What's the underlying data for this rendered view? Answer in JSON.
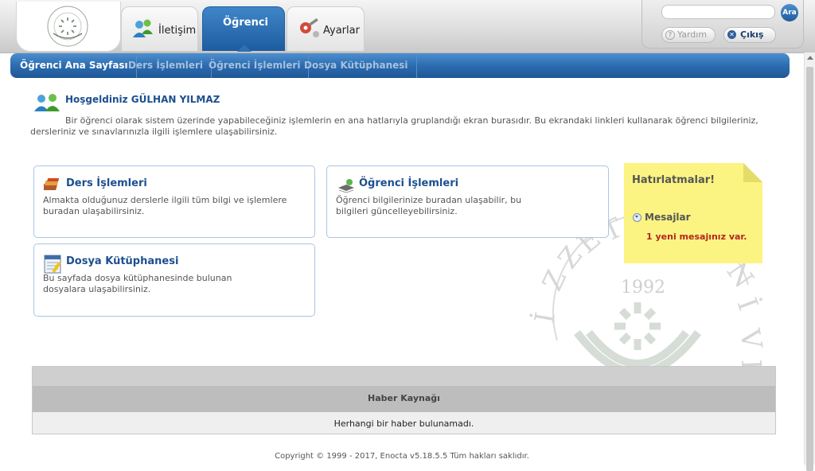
{
  "header": {
    "tabs": [
      {
        "label": "İletişim",
        "icon": "contacts-icon",
        "active": false
      },
      {
        "label": "Öğrenci",
        "icon": "",
        "active": true
      },
      {
        "label": "Ayarlar",
        "icon": "settings-icon",
        "active": false
      }
    ],
    "search": {
      "placeholder": "",
      "button_label": "Ara"
    },
    "help_label": "Yardım",
    "logout_label": "Çıkış"
  },
  "subnav": {
    "items": [
      {
        "label": "Öğrenci Ana Sayfası",
        "active": true
      },
      {
        "label": "Ders İşlemleri",
        "active": false
      },
      {
        "label": "Öğrenci İşlemleri",
        "active": false
      },
      {
        "label": "Dosya Kütüphanesi",
        "active": false
      }
    ]
  },
  "welcome": {
    "title": "Hoşgeldiniz GÜLHAN YILMAZ",
    "description": "Bir öğrenci olarak sistem üzerinde yapabileceğiniz işlemlerin en ana hatlarıyla gruplandığı ekran burasıdır. Bu ekrandaki linkleri kullanarak öğrenci bilgileriniz, dersleriniz ve sınavlarınızla ilgili işlemlere ulaşabilirsiniz."
  },
  "cards": [
    {
      "title": "Ders İşlemleri",
      "description": "Almakta olduğunuz derslerle ilgili tüm bilgi ve işlemlere buradan ulaşabilirsiniz.",
      "icon": "courses-icon"
    },
    {
      "title": "Öğrenci İşlemleri",
      "description": "Öğrenci bilgilerinize buradan ulaşabilir, bu bilgileri güncelleyebilirsiniz.",
      "icon": "student-icon"
    },
    {
      "title": "Dosya Kütüphanesi",
      "description": "Bu sayfada dosya kütüphanesinde bulunan dosyalara ulaşabilirsiniz.",
      "icon": "file-library-icon"
    }
  ],
  "reminders": {
    "title": "Hatırlatmalar!",
    "messages_label": "Mesajlar",
    "messages_text": "1 yeni mesajınız var."
  },
  "watermark": {
    "year": "1992"
  },
  "news": {
    "title": "Haber Kaynağı",
    "empty_text": "Herhangi bir haber bulunamadı."
  },
  "footer": {
    "copyright": "Copyright © 1999 - 2017, Enocta v5.18.5.5 Tüm hakları saklıdır."
  },
  "colors": {
    "primary_blue": "#2c6cb0",
    "title_blue": "#1d4f8f",
    "note_yellow": "#fbf482",
    "alert_red": "#b3261e"
  }
}
